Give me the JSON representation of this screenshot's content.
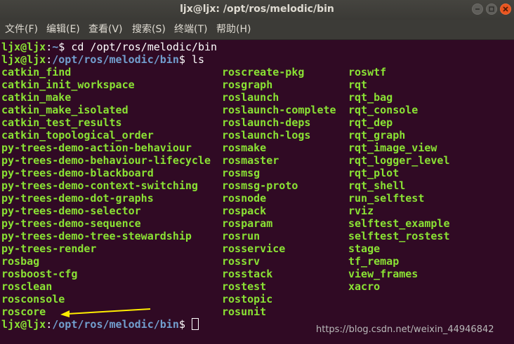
{
  "window": {
    "title": "ljx@ljx: /opt/ros/melodic/bin"
  },
  "menu": [
    {
      "label": "文件(F)"
    },
    {
      "label": "编辑(E)"
    },
    {
      "label": "查看(V)"
    },
    {
      "label": "搜索(S)"
    },
    {
      "label": "终端(T)"
    },
    {
      "label": "帮助(H)"
    }
  ],
  "terminal": {
    "prompts": [
      {
        "user": "ljx@ljx",
        "sep": ":",
        "path": "~",
        "symbol": "$",
        "command": " cd /opt/ros/melodic/bin"
      },
      {
        "user": "ljx@ljx",
        "sep": ":",
        "path": "/opt/ros/melodic/bin",
        "symbol": "$",
        "command": " ls"
      },
      {
        "user": "ljx@ljx",
        "sep": ":",
        "path": "/opt/ros/melodic/bin",
        "symbol": "$",
        "command": ""
      }
    ],
    "ls_columns": [
      [
        "catkin_find",
        "catkin_init_workspace",
        "catkin_make",
        "catkin_make_isolated",
        "catkin_test_results",
        "catkin_topological_order",
        "py-trees-demo-action-behaviour",
        "py-trees-demo-behaviour-lifecycle",
        "py-trees-demo-blackboard",
        "py-trees-demo-context-switching",
        "py-trees-demo-dot-graphs",
        "py-trees-demo-selector",
        "py-trees-demo-sequence",
        "py-trees-demo-tree-stewardship",
        "py-trees-render",
        "rosbag",
        "rosboost-cfg",
        "rosclean",
        "rosconsole",
        "roscore"
      ],
      [
        "roscreate-pkg",
        "rosgraph",
        "roslaunch",
        "roslaunch-complete",
        "roslaunch-deps",
        "roslaunch-logs",
        "rosmake",
        "rosmaster",
        "rosmsg",
        "rosmsg-proto",
        "rosnode",
        "rospack",
        "rosparam",
        "rosrun",
        "rosservice",
        "rossrv",
        "rosstack",
        "rostest",
        "rostopic",
        "rosunit"
      ],
      [
        "roswtf",
        "rqt",
        "rqt_bag",
        "rqt_console",
        "rqt_dep",
        "rqt_graph",
        "rqt_image_view",
        "rqt_logger_level",
        "rqt_plot",
        "rqt_shell",
        "run_selftest",
        "rviz",
        "selftest_example",
        "selftest_rostest",
        "stage",
        "tf_remap",
        "view_frames",
        "xacro"
      ]
    ]
  },
  "watermark": "https://blog.csdn.net/weixin_44946842",
  "colors": {
    "background": "#300a24",
    "user_green": "#8ae234",
    "path_blue": "#729fcf",
    "annotation_arrow": "#ffee00"
  }
}
